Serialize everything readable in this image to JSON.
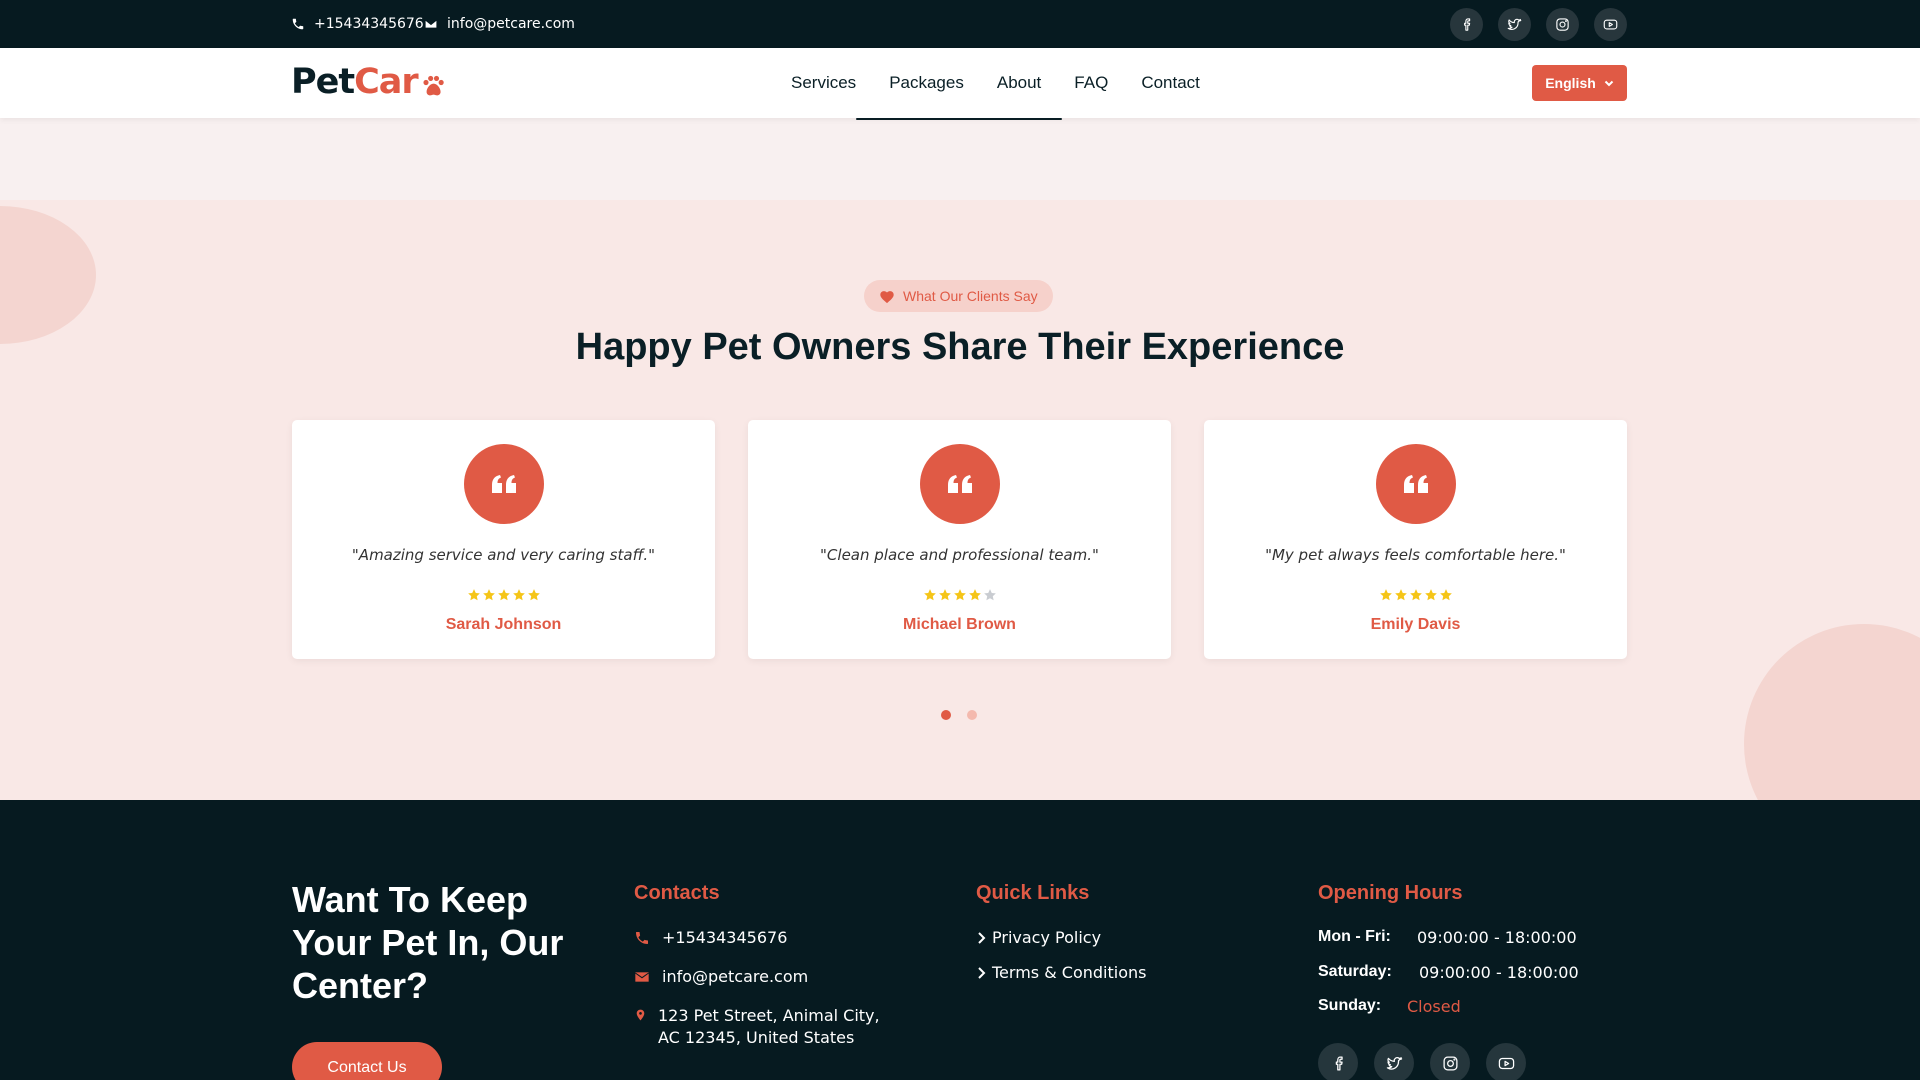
{
  "topbar": {
    "phone": "+15434345676",
    "email": "info@petcare.com",
    "socials": [
      "facebook-icon",
      "twitter-icon",
      "instagram-icon",
      "youtube-icon"
    ]
  },
  "nav": {
    "logo_part1": "Pet",
    "logo_part2": "Car",
    "links": [
      "Services",
      "Packages",
      "About",
      "FAQ",
      "Contact"
    ],
    "language": "English"
  },
  "testimonials": {
    "badge": "What Our Clients Say",
    "title": "Happy Pet Owners Share Their Experience",
    "cards": [
      {
        "text": "\"Amazing service and very caring staff.\"",
        "rating": 5,
        "name": "Sarah Johnson"
      },
      {
        "text": "\"Clean place and professional team.\"",
        "rating": 4,
        "name": "Michael Brown"
      },
      {
        "text": "\"My pet always feels comfortable here.\"",
        "rating": 5,
        "name": "Emily Davis"
      }
    ],
    "pages": 2,
    "active_page": 1
  },
  "footer": {
    "cta_title": "Want To Keep Your Pet In, Our Center?",
    "cta_button": "Contact Us",
    "contacts_title": "Contacts",
    "phone": "+15434345676",
    "email": "info@petcare.com",
    "address_line1": "123 Pet Street, Animal City,",
    "address_line2": "AC 12345, United States",
    "links_title": "Quick Links",
    "links": [
      "Privacy Policy",
      "Terms & Conditions"
    ],
    "hours_title": "Opening Hours",
    "hours": [
      {
        "day": "Mon - Fri:",
        "time": "09:00:00 - 18:00:00"
      },
      {
        "day": "Saturday:",
        "time": "09:00:00 - 18:00:00"
      },
      {
        "day": "Sunday:",
        "time": "Closed"
      }
    ]
  },
  "colors": {
    "accent": "#e05a45",
    "dark": "#061a20",
    "section_bg": "#f9e8e6",
    "star": "#f5c518",
    "star_empty": "#c9ccd1"
  }
}
